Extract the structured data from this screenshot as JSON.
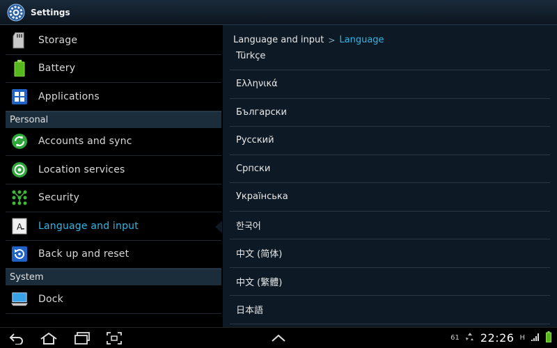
{
  "titlebar": {
    "title": "Settings",
    "icon": "gear-icon"
  },
  "left": {
    "items_top": [
      {
        "label": "Storage",
        "icon": "sd-card-icon"
      },
      {
        "label": "Battery",
        "icon": "battery-icon"
      },
      {
        "label": "Applications",
        "icon": "apps-grid-icon"
      }
    ],
    "section_personal": "Personal",
    "items_personal": [
      {
        "label": "Accounts and sync",
        "icon": "sync-icon"
      },
      {
        "label": "Location services",
        "icon": "location-icon"
      },
      {
        "label": "Security",
        "icon": "lock-pattern-icon"
      },
      {
        "label": "Language and input",
        "icon": "keyboard-a-icon",
        "selected": true
      },
      {
        "label": "Back up and reset",
        "icon": "backup-icon"
      }
    ],
    "section_system": "System",
    "items_system": [
      {
        "label": "Dock",
        "icon": "dock-icon"
      }
    ]
  },
  "right": {
    "breadcrumb_parent": "Language and input",
    "breadcrumb_sep": ">",
    "breadcrumb_current": "Language",
    "languages": [
      "Türkçe",
      "Ελληνικά",
      "Български",
      "Русский",
      "Српски",
      "Українська",
      "한국어",
      "中文 (简体)",
      "中文 (繁體)",
      "日本語"
    ]
  },
  "navbar": {
    "battery_percent": "61",
    "clock": "22:26",
    "signal_label": "H"
  },
  "colors": {
    "accent": "#33b5e5",
    "right_bg": "#0d1a25",
    "section_bg": "#1b2c3b"
  }
}
